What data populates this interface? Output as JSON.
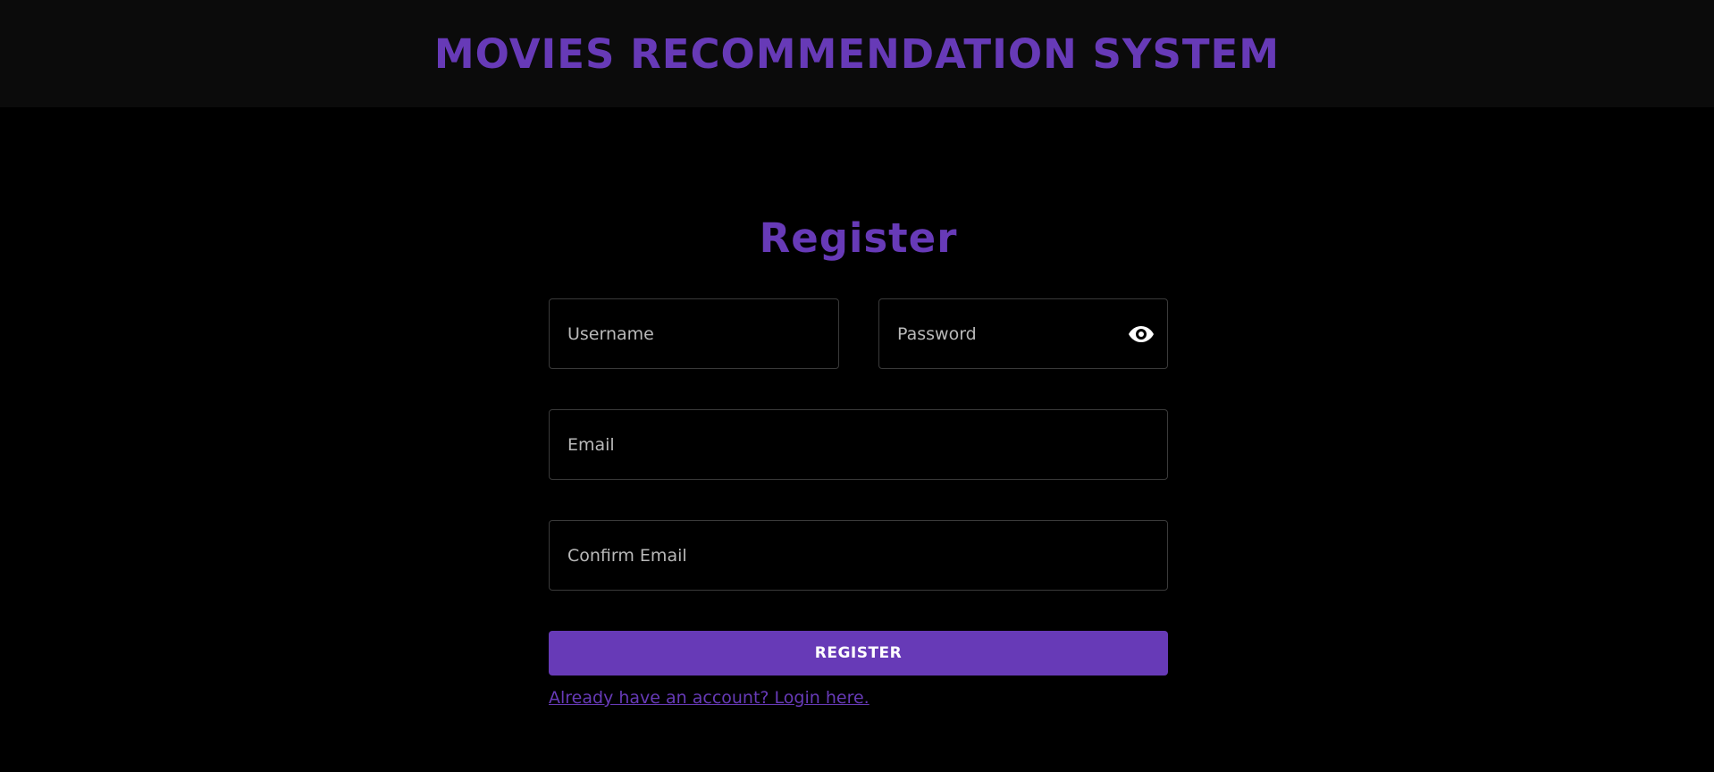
{
  "header": {
    "title": "MOVIES RECOMMENDATION SYSTEM"
  },
  "form": {
    "title": "Register",
    "username": {
      "placeholder": "Username",
      "value": ""
    },
    "password": {
      "placeholder": "Password",
      "value": "",
      "toggle_icon": "eye-icon"
    },
    "email": {
      "placeholder": "Email",
      "value": ""
    },
    "confirm_email": {
      "placeholder": "Confirm Email",
      "value": ""
    },
    "submit_label": "REGISTER",
    "login_link": "Already have an account? Login here."
  },
  "colors": {
    "accent": "#673ab7",
    "background": "#000000",
    "header_background": "#0b0b0b",
    "field_border": "#3a3a3a"
  }
}
